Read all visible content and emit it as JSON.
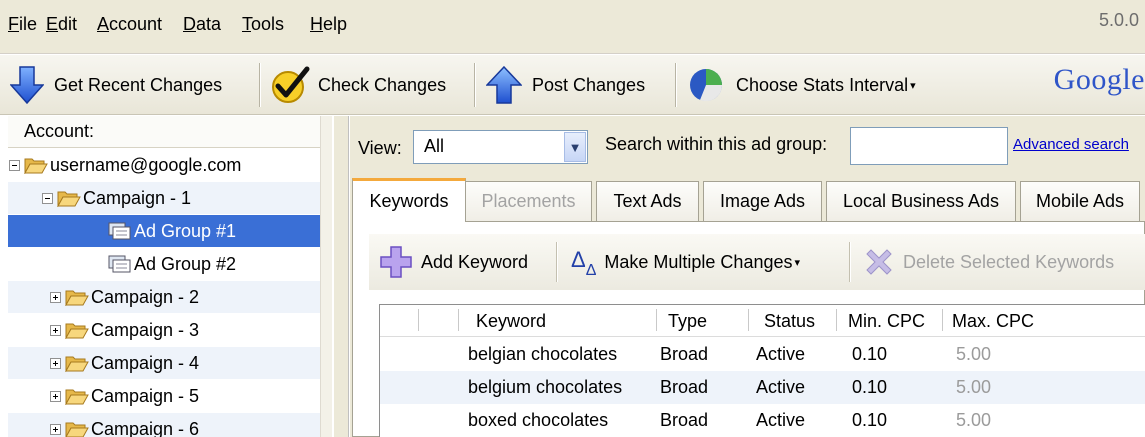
{
  "menu": {
    "items": [
      {
        "label": "File",
        "ul": "F",
        "rest": "ile"
      },
      {
        "label": "Edit",
        "ul": "E",
        "rest": "dit"
      },
      {
        "label": "Account",
        "ul": "A",
        "rest": "ccount"
      },
      {
        "label": "Data",
        "ul": "D",
        "rest": "ata"
      },
      {
        "label": "Tools",
        "ul": "T",
        "rest": "ools"
      },
      {
        "label": "Help",
        "ul": "H",
        "rest": "elp"
      }
    ],
    "version": "5.0.0"
  },
  "toolbar": {
    "get_recent": "Get Recent Changes",
    "check": "Check Changes",
    "post": "Post Changes",
    "stats": "Choose Stats Interval",
    "logo": "Google"
  },
  "tree": {
    "header": "Account:",
    "account": "username@google.com",
    "campaign1": "Campaign - 1",
    "adgroup1": "Ad Group #1",
    "adgroup2": "Ad Group #2",
    "campaigns": [
      "Campaign - 2",
      "Campaign - 3",
      "Campaign - 4",
      "Campaign - 5",
      "Campaign - 6"
    ]
  },
  "filter": {
    "view_label": "View:",
    "view_value": "All",
    "search_label": "Search within this ad group:",
    "search_value": "",
    "advanced": "Advanced search"
  },
  "tabs": [
    "Keywords",
    "Placements",
    "Text Ads",
    "Image Ads",
    "Local Business Ads",
    "Mobile Ads"
  ],
  "keyword_toolbar": {
    "add": "Add Keyword",
    "multi": "Make Multiple Changes",
    "delete": "Delete Selected Keywords"
  },
  "grid": {
    "columns": [
      "Keyword",
      "Type",
      "Status",
      "Min. CPC",
      "Max. CPC"
    ],
    "rows": [
      {
        "keyword": "belgian chocolates",
        "type": "Broad",
        "status": "Active",
        "min": "0.10",
        "max": "5.00"
      },
      {
        "keyword": "belgium chocolates",
        "type": "Broad",
        "status": "Active",
        "min": "0.10",
        "max": "5.00"
      },
      {
        "keyword": "boxed chocolates",
        "type": "Broad",
        "status": "Active",
        "min": "0.10",
        "max": "5.00"
      }
    ]
  },
  "colors": {
    "selection": "#3a6fd6",
    "active_tab_accent": "#f4a93c",
    "link": "#0000cc",
    "chrome": "#ece9d8"
  }
}
